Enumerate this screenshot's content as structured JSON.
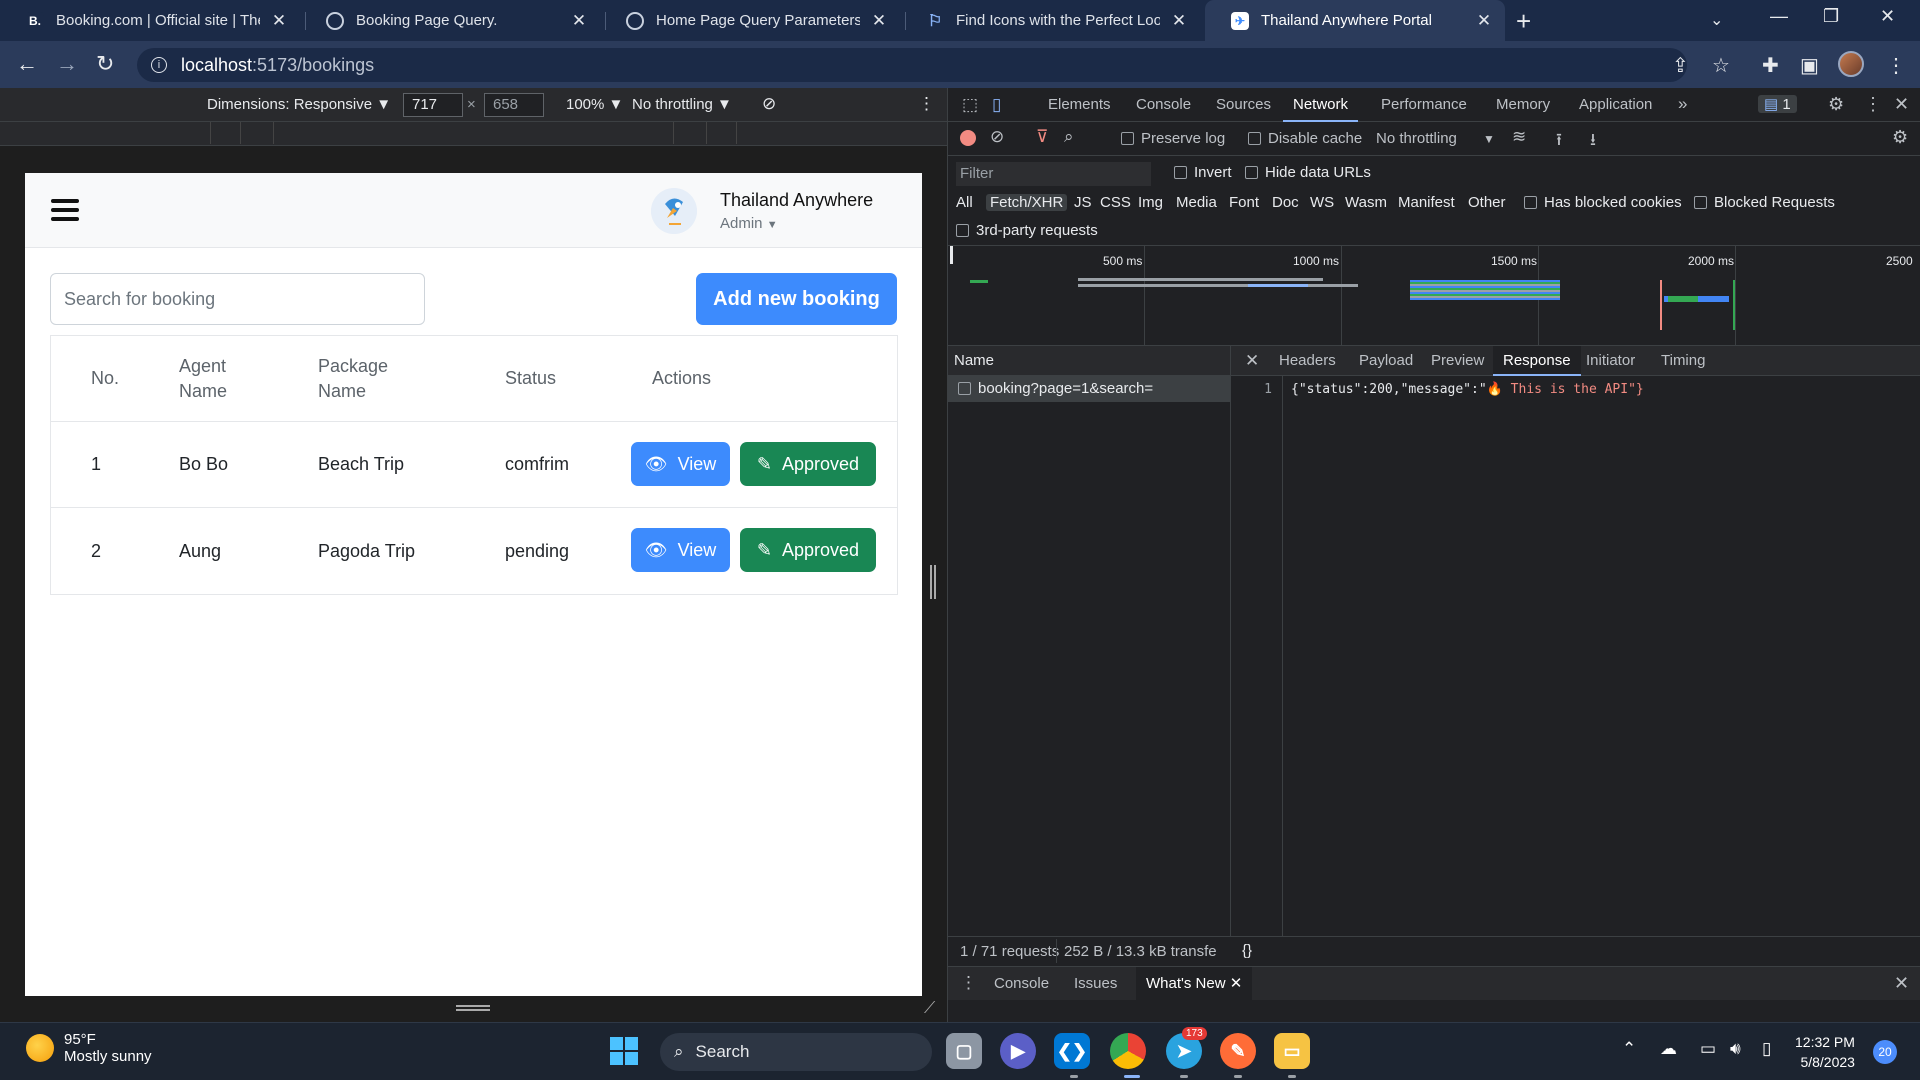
{
  "browser": {
    "tabs": [
      {
        "title": "Booking.com | Official site | The b",
        "favicon": "B."
      },
      {
        "title": "Booking Page Query.",
        "favicon": "chatgpt-icon"
      },
      {
        "title": "Home Page Query Parameters.",
        "favicon": "chatgpt-icon"
      },
      {
        "title": "Find Icons with the Perfect Look &",
        "favicon": "flag-icon"
      },
      {
        "title": "Thailand Anywhere Portal",
        "favicon": "app-icon"
      }
    ],
    "url_host": "localhost",
    "url_path": ":5173/bookings"
  },
  "device_toolbar": {
    "dimensions": "Dimensions: Responsive ▼",
    "width": "717",
    "times": "×",
    "height": "658",
    "zoom": "100% ▼",
    "throttling": "No throttling ▼"
  },
  "app": {
    "brand_name": "Thailand Anywhere",
    "role": "Admin",
    "search_placeholder": "Search for booking",
    "add_button": "Add new booking",
    "columns": [
      "No.",
      "Agent",
      "Name",
      "Package",
      "Name",
      "Status",
      "Actions"
    ],
    "rows": [
      {
        "no": "1",
        "agent": "Bo Bo",
        "package": "Beach Trip",
        "status": "comfrim"
      },
      {
        "no": "2",
        "agent": "Aung",
        "package": "Pagoda Trip",
        "status": "pending"
      }
    ],
    "view_label": "View",
    "approved_label": "Approved"
  },
  "devtools": {
    "tabs": [
      "Elements",
      "Console",
      "Sources",
      "Network",
      "Performance",
      "Memory",
      "Application"
    ],
    "issues_count": "1",
    "preserve_log": "Preserve log",
    "disable_cache": "Disable cache",
    "throttling": "No throttling",
    "filter_placeholder": "Filter",
    "invert": "Invert",
    "hide_data_urls": "Hide data URLs",
    "types": [
      "All",
      "Fetch/XHR",
      "JS",
      "CSS",
      "Img",
      "Media",
      "Font",
      "Doc",
      "WS",
      "Wasm",
      "Manifest",
      "Other"
    ],
    "has_blocked_cookies": "Has blocked cookies",
    "blocked_requests": "Blocked Requests",
    "third_party": "3rd-party requests",
    "timeline_labels": [
      "500 ms",
      "1000 ms",
      "1500 ms",
      "2000 ms",
      "2500"
    ],
    "name_header": "Name",
    "request_name": "booking?page=1&search=",
    "detail_tabs": [
      "Headers",
      "Payload",
      "Preview",
      "Response",
      "Initiator",
      "Timing"
    ],
    "response_line_no": "1",
    "response_prefix": "{\"status\":200,\"message\":\"",
    "response_emoji": "🔥",
    "response_text": " This is the API\"}",
    "requests_count": "1 / 71 requests",
    "transfer": "252 B / 13.3 kB transfe",
    "pretty_print": "{}",
    "drawer_tabs": [
      "Console",
      "Issues",
      "What's New"
    ]
  },
  "taskbar": {
    "temperature": "95°F",
    "weather": "Mostly sunny",
    "search": "Search",
    "telegram_badge": "173",
    "time": "12:32 PM",
    "date": "5/8/2023",
    "notifications": "20"
  }
}
